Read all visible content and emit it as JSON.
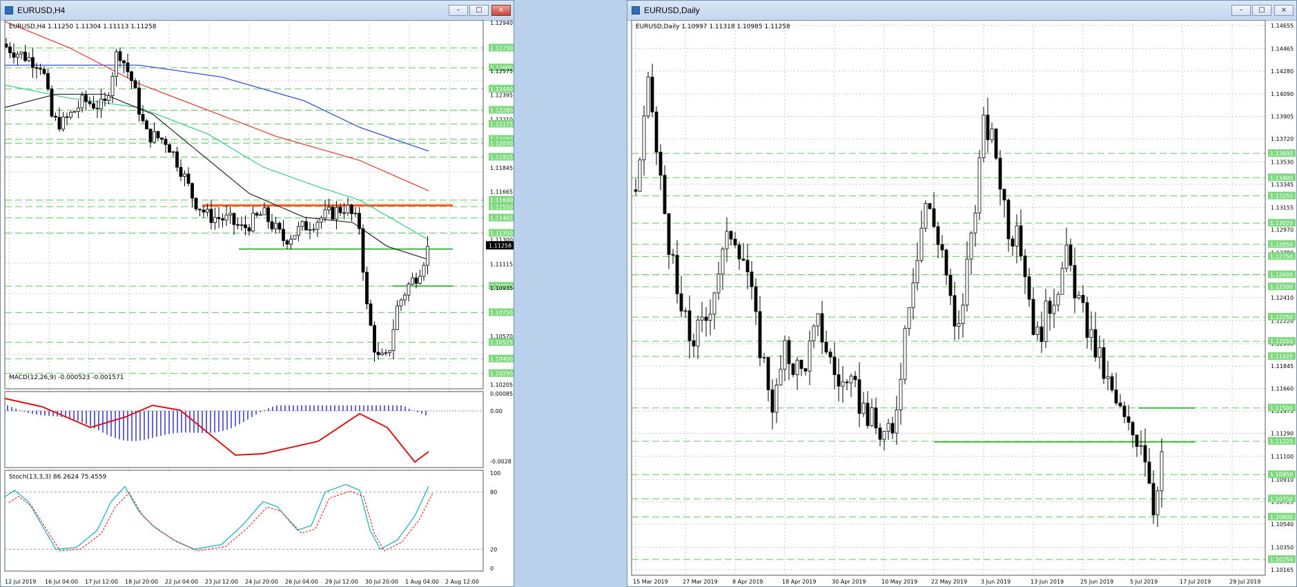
{
  "left_window": {
    "title": "EURUSD,H4",
    "header": "EURUSD,H4  1.11250 1.11304 1.11113 1.11258",
    "price_axis": [
      "1.12940",
      "1.12750",
      "1.12600",
      "1.12575",
      "1.12440",
      "1.12395",
      "1.12280",
      "1.12210",
      "1.12175",
      "1.12060",
      "1.12030",
      "1.11925",
      "1.11845",
      "1.11665",
      "1.11600",
      "1.11550",
      "1.11465",
      "1.11350",
      "1.11300",
      "1.11115",
      "1.10950",
      "1.10935",
      "1.10750",
      "1.10570",
      "1.10525",
      "1.10400",
      "1.10290",
      "1.10205"
    ],
    "current_price": "1.11258",
    "time_axis": [
      "12 Jul 2019",
      "16 Jul 04:00",
      "17 Jul 12:00",
      "18 Jul 20:00",
      "22 Jul 04:00",
      "23 Jul 12:00",
      "24 Jul 20:00",
      "26 Jul 04:00",
      "29 Jul 12:00",
      "30 Jul 20:00",
      "1 Aug 04:00",
      "2 Aug 12:00"
    ],
    "macd": {
      "label": "MACD(12,26,9) -0.000523 -0.001571",
      "axis": [
        "0.000851",
        "0.00",
        "-0.0028"
      ]
    },
    "stoch": {
      "label": "Stoch(13,3,3) 86.2624 75.4559",
      "axis": [
        "100",
        "80",
        "20",
        "0"
      ]
    }
  },
  "right_window": {
    "title": "EURUSD,Daily",
    "header": "EURUSD,Daily  1.10997 1.11318 1.10985 1.11258",
    "price_axis": [
      "1.14655",
      "1.14465",
      "1.14280",
      "1.14090",
      "1.13905",
      "1.13720",
      "1.13530",
      "1.13345",
      "1.13155",
      "1.12970",
      "1.12780",
      "1.12595",
      "1.12410",
      "1.12220",
      "1.12030",
      "1.11845",
      "1.11660",
      "1.11475",
      "1.11290",
      "1.11100",
      "1.10910",
      "1.10725",
      "1.10540",
      "1.10350",
      "1.10165"
    ],
    "green_levels": [
      "1.13600",
      "1.13400",
      "1.13250",
      "1.13025",
      "1.12850",
      "1.12750",
      "1.12600",
      "1.12500",
      "1.12250",
      "1.12050",
      "1.11925",
      "1.11500",
      "1.11225",
      "1.10950",
      "1.10750",
      "1.10600",
      "1.10250"
    ],
    "time_axis": [
      "15 Mar 2019",
      "27 Mar 2019",
      "8 Apr 2019",
      "18 Apr 2019",
      "30 Apr 2019",
      "10 May 2019",
      "22 May 2019",
      "3 Jun 2019",
      "13 Jun 2019",
      "25 Jun 2019",
      "5 Jul 2019",
      "17 Jul 2019",
      "29 Jul 2019"
    ]
  },
  "window_buttons": {
    "minimize": "–",
    "maximize": "□",
    "close": "×"
  },
  "colors": {
    "grid": "#c8c8c8",
    "level": "#5ec85e",
    "ma_blue": "#1f3fd6",
    "ma_red": "#e0342a",
    "ma_teal": "#33cc88",
    "ma_black": "#222222",
    "resistance": "#ff5a1e",
    "macd_line": "#e01010",
    "macd_hist": "#2222cc",
    "stoch_main": "#20b0c0",
    "stoch_signal": "#e02020"
  }
}
